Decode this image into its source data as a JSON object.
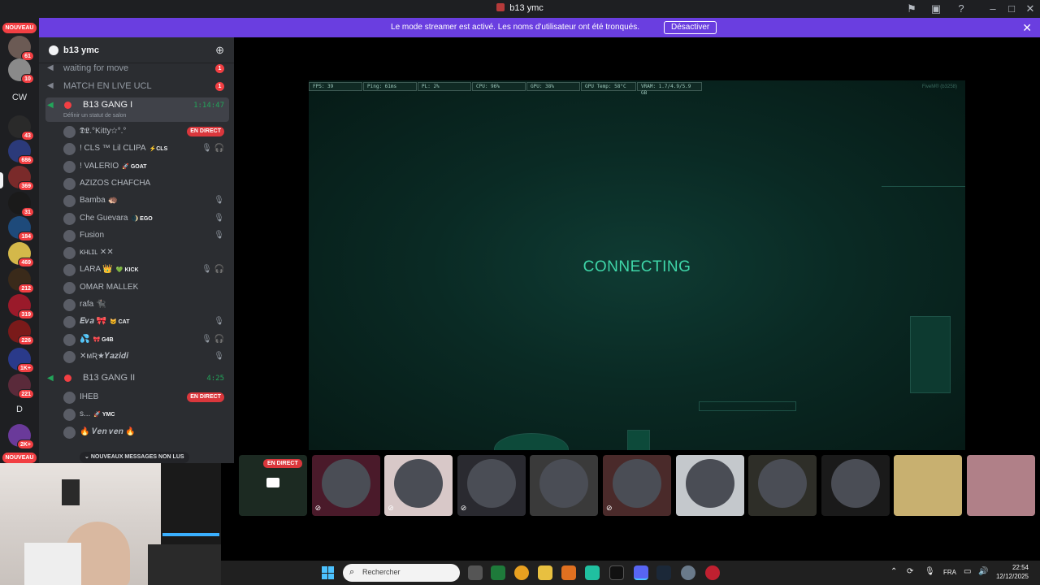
{
  "window": {
    "title": "b13 ymc"
  },
  "banner": {
    "message": "Le mode streamer est activé. Les noms d'utilisateur ont été tronqués.",
    "button": "Désactiver"
  },
  "servers": {
    "nouveau_top": "NOUVEAU",
    "nouveau_bottom": "NOUVEAU",
    "items": [
      {
        "badge": "61"
      },
      {
        "badge": "10"
      },
      {
        "text": "CW"
      },
      {
        "badge": "43"
      },
      {
        "badge": "686"
      },
      {
        "badge": "369"
      },
      {
        "badge": "31"
      },
      {
        "badge": "184"
      },
      {
        "badge": "469"
      },
      {
        "badge": "212"
      },
      {
        "badge": "319"
      },
      {
        "badge": "226"
      },
      {
        "badge": "1K+"
      },
      {
        "badge": "221"
      },
      {
        "text": "D",
        "badge": "1"
      },
      {
        "badge": "2K+"
      }
    ]
  },
  "guild": {
    "name": "b13 ymc"
  },
  "channels": [
    {
      "name": "waiting for move",
      "unread": "1"
    },
    {
      "name": "MATCH EN LIVE UCL",
      "unread": "1"
    }
  ],
  "active_channel": {
    "name": "B13 GANG I",
    "timer": "1:14:47",
    "status": "Définir un statut de salon"
  },
  "members_gang1": [
    {
      "name": "𝕯𝕷.°Kitty☆°.°",
      "live": "EN DIRECT"
    },
    {
      "name": "! CLS ™ Lil CLIPA",
      "tag": "⚡CLS",
      "icons": "🎙 🎧"
    },
    {
      "name": "! VALERIO",
      "tag": "🚀 GOAT"
    },
    {
      "name": "AZIZOS CHAFCHA"
    },
    {
      "name": "Bamba 🦔",
      "icons": "🎙"
    },
    {
      "name": "Che Guevara",
      "tag": "🌒 EGO",
      "icons": "🎙"
    },
    {
      "name": "Fusion",
      "icons": "🎙"
    },
    {
      "name": "ĸʜʟɪʟ ✕✕"
    },
    {
      "name": "LARA 👑",
      "tag": "💚 KICK",
      "icons": "🎙 🎧"
    },
    {
      "name": "OMAR MALLEK"
    },
    {
      "name": "rafa 🐈‍⬛"
    },
    {
      "name": "𝑬𝒗𝒂 🎀",
      "tag": "😺 CAT",
      "icons": "🎙"
    },
    {
      "name": "💦",
      "tag": "🎀 G4B",
      "icons": "🎙 🎧"
    },
    {
      "name": "✕ᴍƦ★𝒀𝒂𝒛𝒊𝒅𝒊",
      "icons": "🎙"
    }
  ],
  "channel2": {
    "name": "B13 GANG II",
    "timer": "4:25"
  },
  "members_gang2": [
    {
      "name": "IHEB",
      "live": "EN DIRECT"
    },
    {
      "name": "s...",
      "tag": "🚀 YMC"
    },
    {
      "name": "🔥 𝑽𝒆𝒏 𝒗𝒆𝒏 🔥"
    }
  ],
  "new_messages": "NOUVEAUX MESSAGES NON LUS",
  "video": {
    "hud": [
      "FPS: 39",
      "Ping: 61ms",
      "PL: 2%",
      "CPU: 96%",
      "GPU: 38%",
      "GPU Temp: 58°C",
      "VRAM: 1.7/4.9/5.9 GB"
    ],
    "status": "CONNECTING",
    "corner": "FiveM® (b3258)"
  },
  "tiles": [
    {
      "live": "EN DIRECT",
      "color": "#1c2a22"
    },
    {
      "color": "#4a1a2a",
      "muted": true
    },
    {
      "color": "#d8c8c8",
      "muted": true
    },
    {
      "color": "#2a2a30",
      "muted": true
    },
    {
      "color": "#3a3a3a"
    },
    {
      "color": "#4a2a2a",
      "muted": true
    },
    {
      "color": "#c4c8cc"
    },
    {
      "color": "#2e2e28"
    },
    {
      "color": "#1a1a1a"
    },
    {
      "color": "#c8b070"
    },
    {
      "color": "#b08088"
    }
  ],
  "taskbar": {
    "search_placeholder": "Rechercher",
    "lang": "FRA",
    "time": "22:54",
    "date": "12/12/2025"
  },
  "colors": {
    "accent": "#6a3ee0",
    "live": "#da373c",
    "connected": "#23a55a",
    "video_text": "#3fd7a9"
  }
}
